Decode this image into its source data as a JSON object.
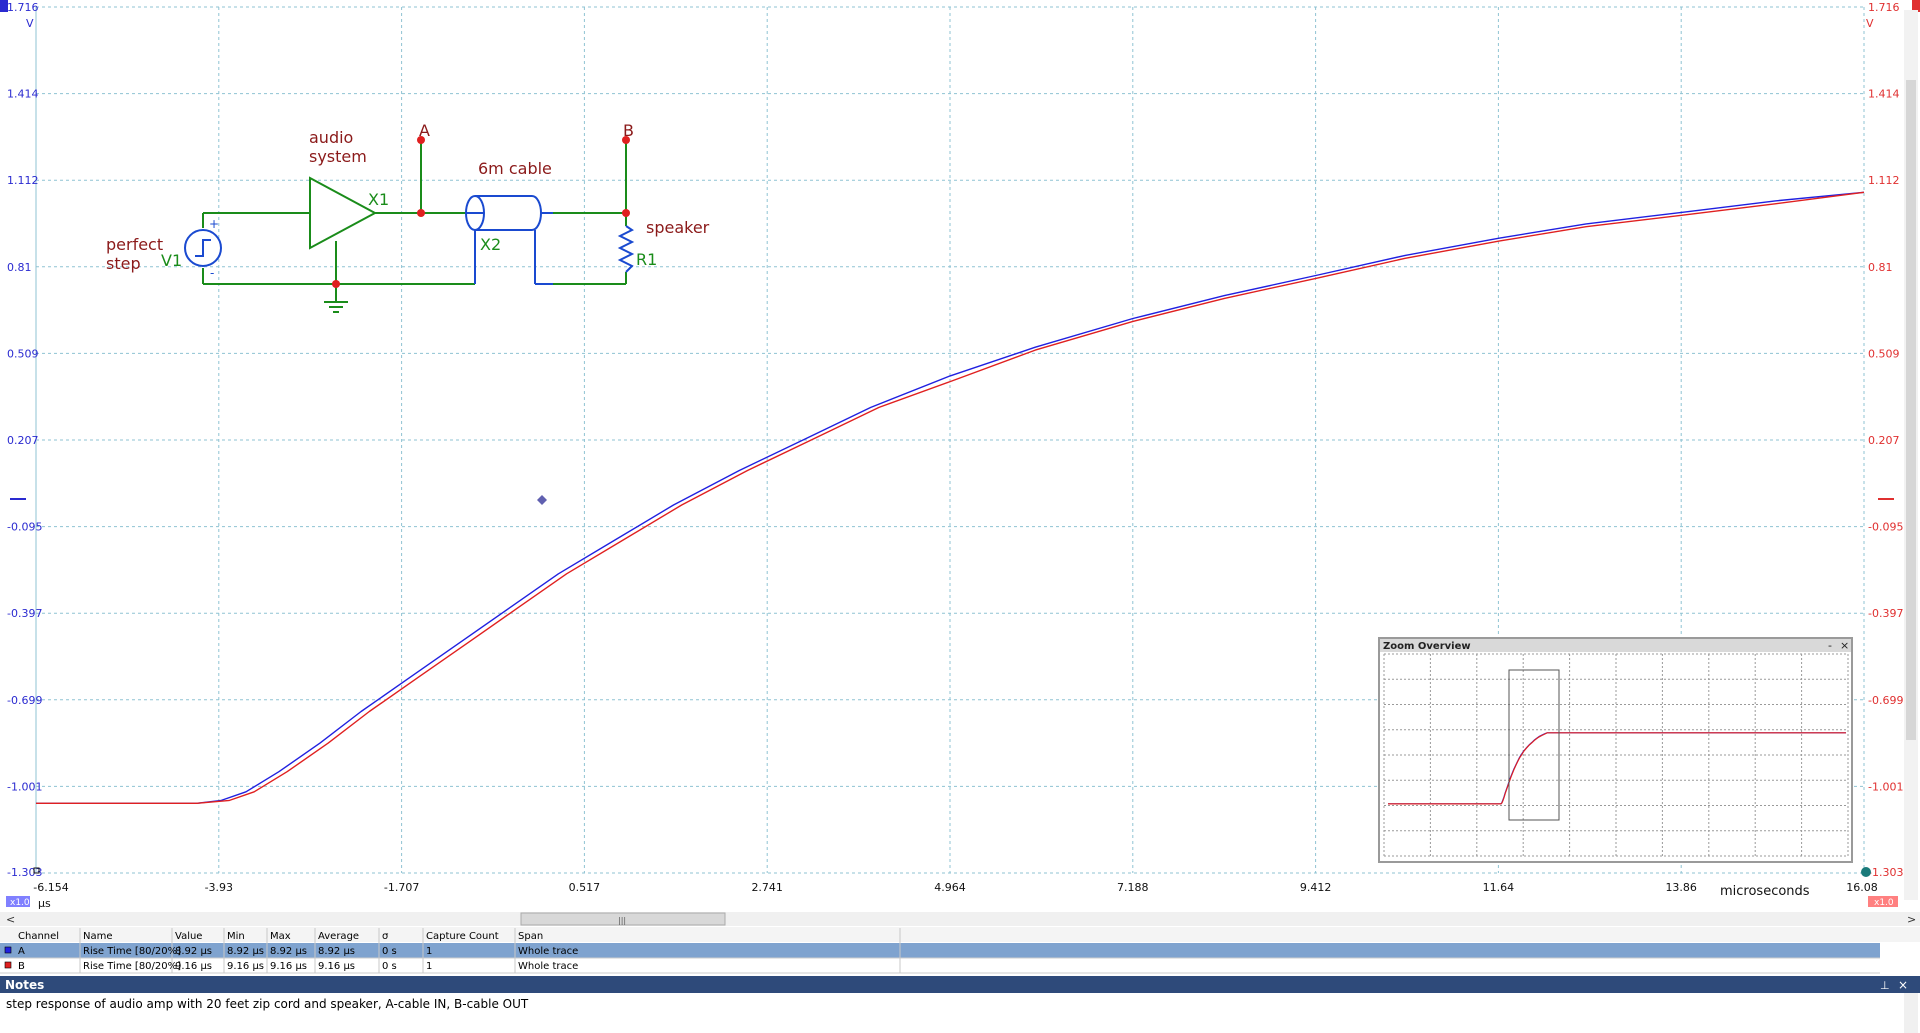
{
  "chart_data": {
    "type": "line",
    "xlabel": "microseconds",
    "xunit": "µs",
    "xlim": [
      -6.154,
      16.08
    ],
    "ylim": [
      -1.303,
      1.716
    ],
    "yunit": "V",
    "x_ticks": [
      "-6.154",
      "-3.93",
      "-1.707",
      "0.517",
      "2.741",
      "4.964",
      "7.188",
      "9.412",
      "11.64",
      "13.86",
      "16.08"
    ],
    "y_ticks": [
      "1.716",
      "1.414",
      "1.112",
      "0.81",
      "0.509",
      "0.207",
      "-0.095",
      "-0.397",
      "-0.699",
      "-1.001",
      "-1.303"
    ],
    "grid": true,
    "series": [
      {
        "name": "A",
        "color": "#2020e0",
        "x": [
          -6.154,
          -4.2,
          -3.9,
          -3.6,
          -3.2,
          -2.7,
          -2.2,
          -1.6,
          -1.0,
          -0.4,
          0.2,
          0.9,
          1.6,
          2.4,
          3.2,
          4.0,
          4.964,
          6.0,
          7.188,
          8.3,
          9.412,
          10.5,
          11.64,
          12.7,
          13.86,
          15.0,
          16.08
        ],
        "y": [
          -1.06,
          -1.06,
          -1.05,
          -1.02,
          -0.95,
          -0.85,
          -0.74,
          -0.62,
          -0.5,
          -0.38,
          -0.26,
          -0.14,
          -0.02,
          0.1,
          0.21,
          0.32,
          0.43,
          0.53,
          0.63,
          0.71,
          0.78,
          0.85,
          0.91,
          0.96,
          1.0,
          1.04,
          1.07
        ]
      },
      {
        "name": "B",
        "color": "#e02020",
        "x": [
          -6.154,
          -4.2,
          -3.8,
          -3.5,
          -3.1,
          -2.6,
          -2.1,
          -1.5,
          -0.9,
          -0.3,
          0.3,
          1.0,
          1.7,
          2.5,
          3.3,
          4.1,
          4.964,
          6.0,
          7.188,
          8.3,
          9.412,
          10.5,
          11.64,
          12.7,
          13.86,
          15.0,
          16.08
        ],
        "y": [
          -1.06,
          -1.06,
          -1.05,
          -1.02,
          -0.95,
          -0.85,
          -0.74,
          -0.62,
          -0.5,
          -0.38,
          -0.26,
          -0.14,
          -0.02,
          0.1,
          0.21,
          0.32,
          0.41,
          0.52,
          0.62,
          0.7,
          0.77,
          0.84,
          0.9,
          0.95,
          0.99,
          1.03,
          1.07
        ]
      }
    ]
  },
  "scope": {
    "left_unit": "V",
    "right_unit": "V",
    "zoom_left": "x1.0",
    "zoom_right": "x1.0"
  },
  "circuit": {
    "label_perfect": "perfect",
    "label_step": "step",
    "label_v1": "V1",
    "label_audio": "audio",
    "label_system": "system",
    "label_x1": "X1",
    "label_a": "A",
    "label_b": "B",
    "label_cable": "6m cable",
    "label_x2": "X2",
    "label_speaker": "speaker",
    "label_r1": "R1",
    "label_plus": "+",
    "label_minus": "-"
  },
  "zoom_overview": {
    "title": "Zoom Overview",
    "min_btn": "-",
    "close_btn": "×"
  },
  "measurements": {
    "headers": [
      "Channel",
      "Name",
      "Value",
      "Min",
      "Max",
      "Average",
      "σ",
      "Capture Count",
      "Span"
    ],
    "rows": [
      [
        "A",
        "Rise Time  [80/20%]",
        "8.92 µs",
        "8.92 µs",
        "8.92 µs",
        "8.92 µs",
        "0 s",
        "1",
        "Whole trace"
      ],
      [
        "B",
        "Rise Time  [80/20%]",
        "9.16 µs",
        "9.16 µs",
        "9.16 µs",
        "9.16 µs",
        "0 s",
        "1",
        "Whole trace"
      ]
    ],
    "row_colors": [
      "#2020e0",
      "#e02020"
    ]
  },
  "notes": {
    "title": "Notes",
    "pin": "⊥",
    "close": "×",
    "text": "step response of audio amp with 20 feet zip cord and speaker, A-cable IN, B-cable OUT"
  },
  "scrollbar": {
    "left_arrow": "<",
    "right_arrow": ">",
    "thumb_grip": "|||"
  }
}
